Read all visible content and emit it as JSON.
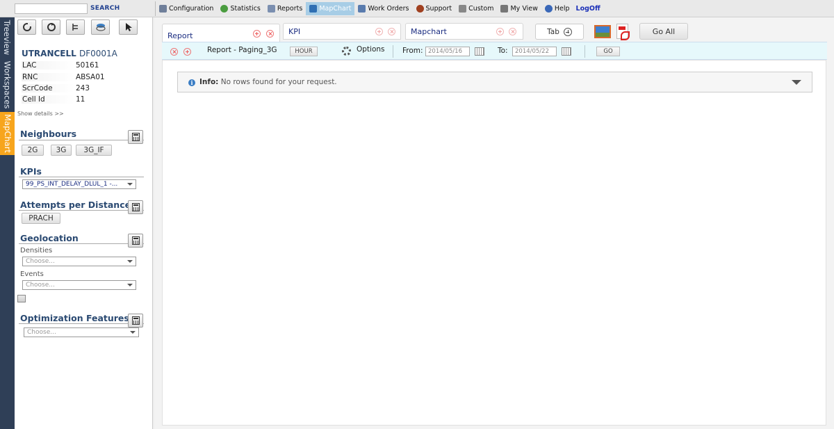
{
  "search": {
    "button_label": "SEARCH",
    "value": ""
  },
  "menu": {
    "items": [
      {
        "label": "Configuration",
        "icon": "wrench-icon",
        "color": "#6f7f9a"
      },
      {
        "label": "Statistics",
        "icon": "pie-chart-icon",
        "color": "#4a9c3f"
      },
      {
        "label": "Reports",
        "icon": "report-icon",
        "color": "#7b8fb0"
      },
      {
        "label": "MapChart",
        "icon": "mapchart-icon",
        "color": "#2f6fb3"
      },
      {
        "label": "Work Orders",
        "icon": "work-orders-icon",
        "color": "#5a7cae"
      },
      {
        "label": "Support",
        "icon": "support-icon",
        "color": "#a04020"
      },
      {
        "label": "Custom",
        "icon": "custom-icon",
        "color": "#888888"
      },
      {
        "label": "My View",
        "icon": "my-view-icon",
        "color": "#777777"
      },
      {
        "label": "Help",
        "icon": "help-icon",
        "color": "#3a68b8"
      }
    ],
    "active": "MapChart",
    "logoff_label": "LogOff"
  },
  "vertical_tabs": [
    {
      "label": "Treeview"
    },
    {
      "label": "Workspaces"
    },
    {
      "label": "MapChart",
      "active": true
    }
  ],
  "cell": {
    "type": "UTRANCELL",
    "name": "DF0001A",
    "fields": [
      {
        "key": "LAC",
        "value": "50161"
      },
      {
        "key": "RNC",
        "value": "ABSA01"
      },
      {
        "key": "ScrCode",
        "value": "243"
      },
      {
        "key": "Cell Id",
        "value": "11"
      }
    ],
    "show_details": "Show details >>"
  },
  "neighbours": {
    "title": "Neighbours",
    "buttons": [
      "2G",
      "3G",
      "3G_IF"
    ]
  },
  "kpis": {
    "title": "KPIs",
    "selected": "99_PS_INT_DELAY_DLUL_1 -..."
  },
  "attempts": {
    "title": "Attempts per Distance",
    "button": "PRACH"
  },
  "geolocation": {
    "title": "Geolocation",
    "densities_label": "Densities",
    "densities_placeholder": "Choose...",
    "events_label": "Events",
    "events_placeholder": "Choose..."
  },
  "optimization": {
    "title": "Optimization Features",
    "placeholder": "Choose..."
  },
  "tabs": [
    {
      "label": "Report"
    },
    {
      "label": "KPI"
    },
    {
      "label": "Mapchart"
    }
  ],
  "tab_add_label": "Tab",
  "go_all_label": "Go All",
  "report_bar": {
    "report_name": "Report - Paging_3G",
    "granularity": "HOUR",
    "options_label": "Options",
    "from_label": "From:",
    "from_date": "2014/05/16",
    "to_label": "To:",
    "to_date": "2014/05/22",
    "go_label": "GO"
  },
  "info": {
    "prefix": "Info:",
    "message": "No rows found for your request."
  }
}
